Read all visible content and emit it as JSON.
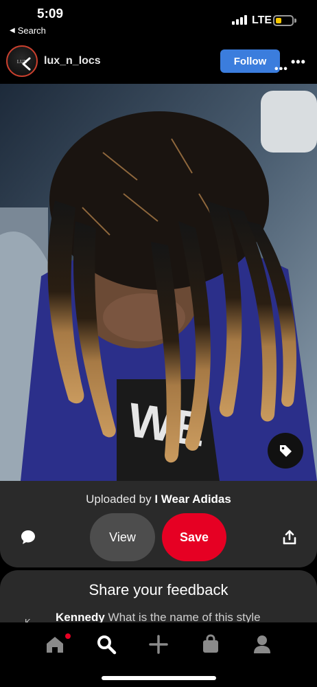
{
  "status_bar": {
    "time": "5:09",
    "back_label": "Search",
    "network": "LTE",
    "battery_color": "#f6c700"
  },
  "header": {
    "username": "lux_n_locs",
    "follow_label": "Follow",
    "more_icon": "more-icon",
    "follow_color": "#3b7ddd"
  },
  "photo": {
    "tag_icon": "tag-icon"
  },
  "pin_actions": {
    "uploaded_prefix": "Uploaded by",
    "uploader": "I Wear Adidas",
    "view_label": "View",
    "save_label": "Save",
    "save_color": "#e60023"
  },
  "feedback": {
    "title": "Share your feedback",
    "comment_author": "Kennedy",
    "comment_text": "What is the name of this style"
  },
  "bottom_nav": {
    "items": [
      "home-icon",
      "search-icon",
      "plus-icon",
      "shopping-bag-icon",
      "profile-icon"
    ]
  }
}
